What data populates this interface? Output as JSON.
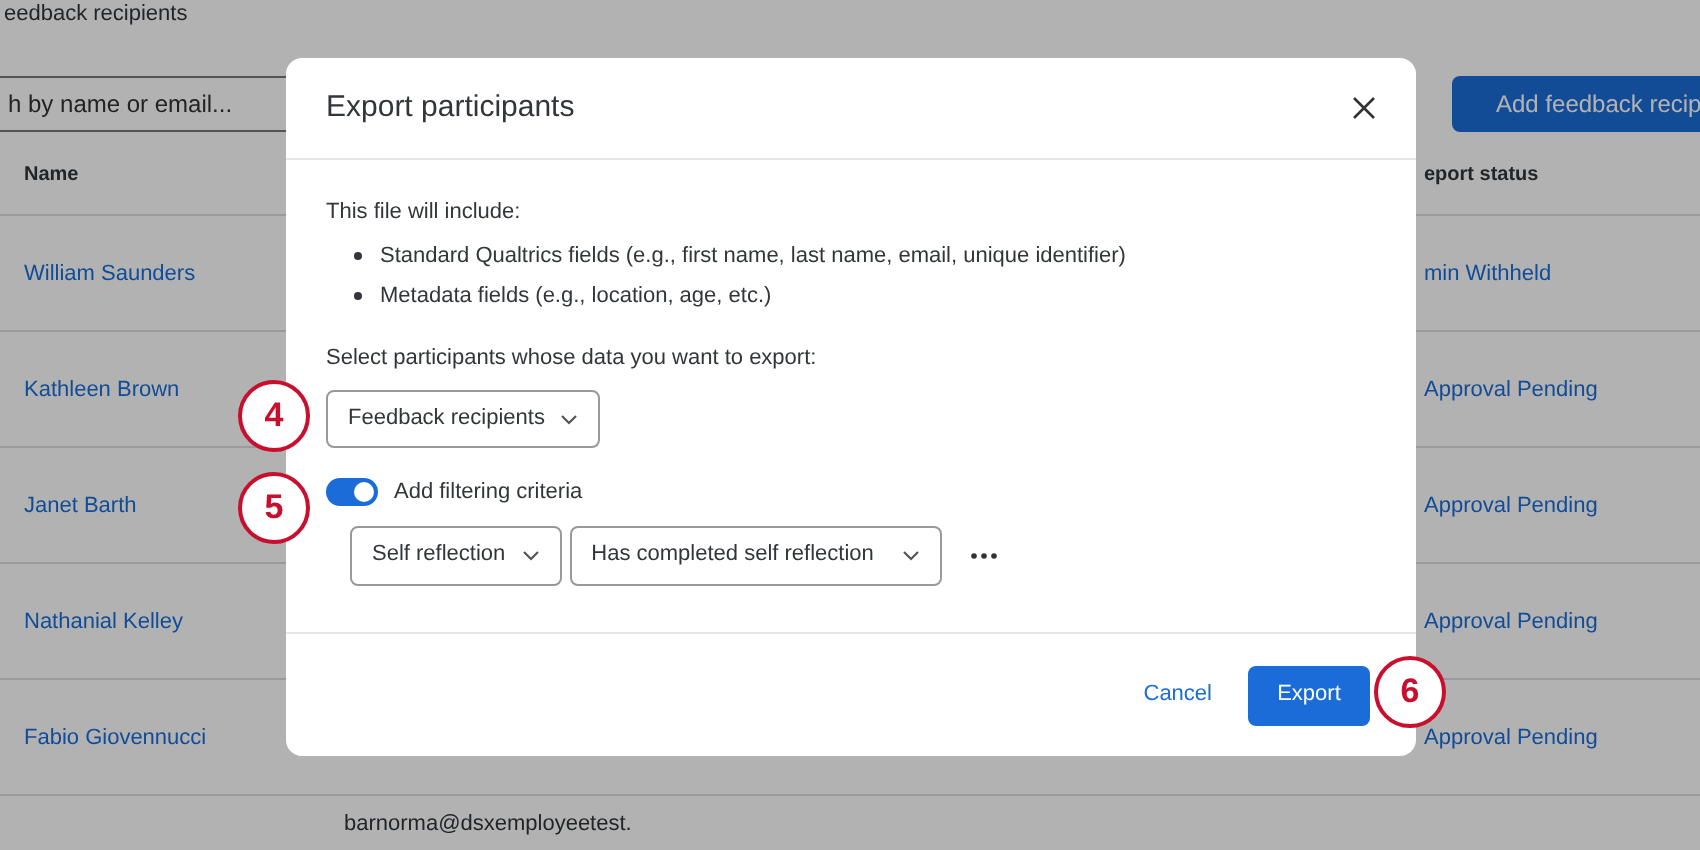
{
  "page": {
    "title": "eedback recipients",
    "search": {
      "placeholder": "h by name or email..."
    },
    "add_button": "Add feedback recip",
    "columns": [
      "Name",
      "eport status"
    ],
    "rows": [
      {
        "name": "William Saunders",
        "status": "min Withheld"
      },
      {
        "name": "Kathleen Brown",
        "status": "Approval Pending"
      },
      {
        "name": "Janet Barth",
        "status": "Approval Pending"
      },
      {
        "name": "Nathanial Kelley",
        "status": "Approval Pending"
      },
      {
        "name": "Fabio Giovennucci",
        "status": "Approval Pending"
      }
    ],
    "partial_row": {
      "email": "barnorma@dsxemployeetest."
    }
  },
  "dialog": {
    "title": "Export participants",
    "intro": "This file will include:",
    "bullets": [
      "Standard Qualtrics fields (e.g., first name, last name, email, unique identifier)",
      "Metadata fields (e.g., location, age, etc.)"
    ],
    "select_label": "Select participants whose data you want to export:",
    "participants_dropdown": "Feedback recipients",
    "filter_toggle": {
      "label": "Add filtering criteria",
      "on": true
    },
    "filters": [
      "Self reflection",
      "Has completed self reflection"
    ],
    "buttons": [
      {
        "label": "Cancel",
        "kind": "link"
      },
      {
        "label": "Export",
        "kind": "primary"
      }
    ]
  },
  "callouts": [
    "4",
    "5",
    "6"
  ]
}
